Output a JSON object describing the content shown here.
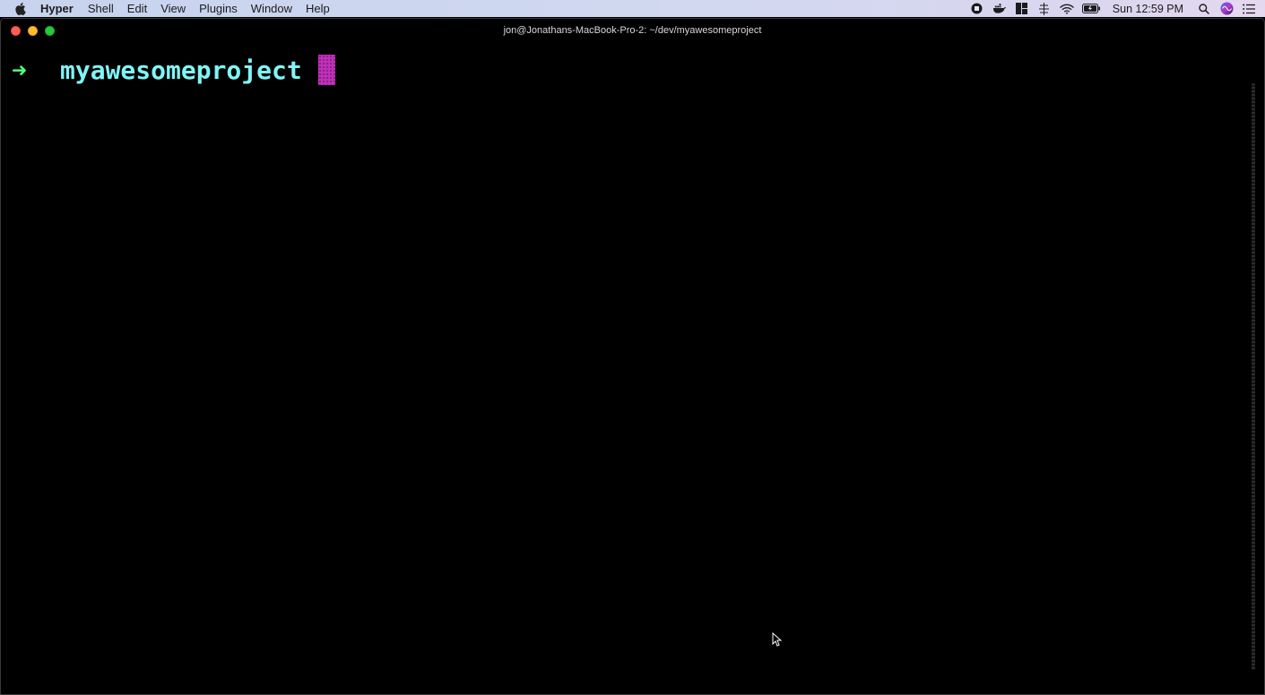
{
  "menubar": {
    "apple_icon": "apple-logo-icon",
    "app_name": "Hyper",
    "items": [
      "Shell",
      "Edit",
      "View",
      "Plugins",
      "Window",
      "Help"
    ],
    "status_icons": [
      "stop-record-icon",
      "docker-icon",
      "window-layout-icon",
      "network-icon",
      "wifi-icon",
      "battery-icon"
    ],
    "clock": "Sun 12:59 PM",
    "right_icons": [
      "spotlight-search-icon",
      "siri-icon",
      "notification-center-icon"
    ]
  },
  "window": {
    "title": "jon@Jonathans-MacBook-Pro-2: ~/dev/myawesomeproject"
  },
  "terminal": {
    "prompt_symbol": "➜",
    "directory": "myawesomeproject",
    "colors": {
      "background": "#000000",
      "prompt_arrow": "#50fa7b",
      "directory": "#7ff5f5",
      "cursor": "#c030b8"
    }
  }
}
